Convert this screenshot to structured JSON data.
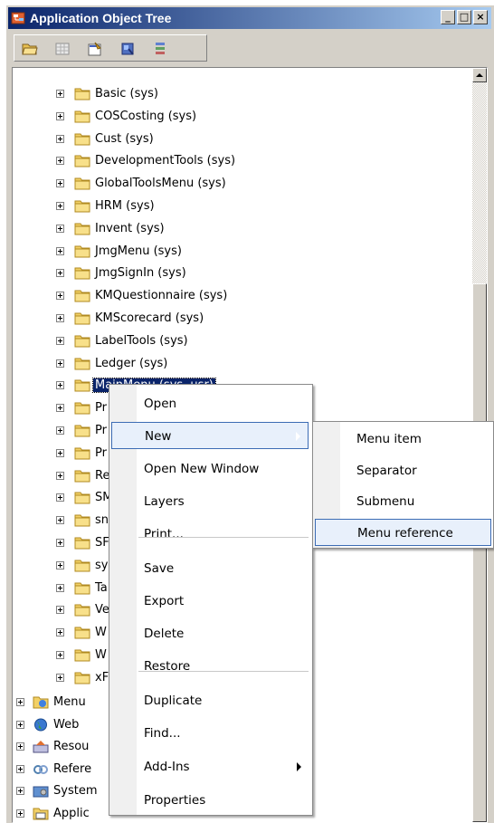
{
  "window": {
    "title": "Application Object Tree"
  },
  "title_buttons": {
    "minimize": "_",
    "maximize": "□",
    "close": "×"
  },
  "toolbar": {
    "icons": [
      "open-folder-icon",
      "grid-icon",
      "properties-icon",
      "compile-icon",
      "sort-icon"
    ]
  },
  "tree": {
    "nodes": [
      {
        "label": "Basic (sys)"
      },
      {
        "label": "COSCosting (sys)"
      },
      {
        "label": "Cust (sys)"
      },
      {
        "label": "DevelopmentTools (sys)"
      },
      {
        "label": "GlobalToolsMenu (sys)"
      },
      {
        "label": "HRM (sys)"
      },
      {
        "label": "Invent (sys)"
      },
      {
        "label": "JmgMenu (sys)"
      },
      {
        "label": "JmgSignIn (sys)"
      },
      {
        "label": "KMQuestionnaire (sys)"
      },
      {
        "label": "KMScorecard (sys)"
      },
      {
        "label": "LabelTools (sys)"
      },
      {
        "label": "Ledger (sys)"
      },
      {
        "label": "MainMenu (sys, usr)"
      },
      {
        "label": "Pr"
      },
      {
        "label": "Pr"
      },
      {
        "label": "Pr"
      },
      {
        "label": "Re"
      },
      {
        "label": "SM"
      },
      {
        "label": "sn"
      },
      {
        "label": "SF"
      },
      {
        "label": "sy"
      },
      {
        "label": "Ta"
      },
      {
        "label": "Ve"
      },
      {
        "label": "W"
      },
      {
        "label": "W"
      },
      {
        "label": "xF"
      }
    ],
    "roots": [
      {
        "label": "Menu"
      },
      {
        "label": "Web"
      },
      {
        "label": "Resou"
      },
      {
        "label": "Refere"
      },
      {
        "label": "System"
      },
      {
        "label": "Applic"
      }
    ]
  },
  "context_menu": {
    "items": [
      "Open",
      "New",
      "Open New Window",
      "Layers",
      "Print...",
      "Save",
      "Export",
      "Delete",
      "Restore",
      "Duplicate",
      "Find...",
      "Add-Ins",
      "Properties"
    ]
  },
  "submenu": {
    "items": [
      "Menu item",
      "Separator",
      "Submenu",
      "Menu reference"
    ]
  },
  "colors": {
    "selection": "#0a246a",
    "title_start": "#0a246a",
    "title_end": "#a6caf0",
    "hover_border": "#3c6cb4"
  }
}
